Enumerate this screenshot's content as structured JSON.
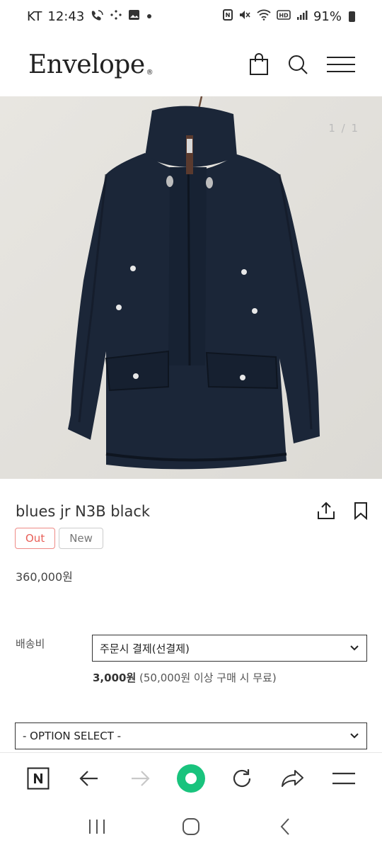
{
  "status_bar": {
    "carrier": "KT",
    "time": "12:43",
    "battery": "91%",
    "icons_left": [
      "wifi-call-icon",
      "dots-icon",
      "gallery-icon",
      "dot-icon"
    ],
    "icons_right": [
      "nfc-icon",
      "mute-icon",
      "wifi-icon",
      "hd-icon",
      "signal-icon",
      "battery-icon"
    ]
  },
  "header": {
    "logo": "Envelope",
    "logo_mark": "®",
    "icons": [
      "shopping-bag-icon",
      "search-icon",
      "menu-icon"
    ]
  },
  "gallery": {
    "counter": "1 / 1"
  },
  "product": {
    "title": "blues jr N3B black",
    "badges": {
      "out": "Out",
      "new": "New"
    },
    "price": "360,000원"
  },
  "shipping": {
    "label": "배송비",
    "method": "주문시 결제(선결제)",
    "fee": "3,000원",
    "fee_note": " (50,000원 이상 구매 시 무료)"
  },
  "option": {
    "selected": "- OPTION SELECT -"
  },
  "browser_toolbar": {
    "buttons": [
      "naver-home-icon",
      "back-icon",
      "forward-icon",
      "green-dot-icon",
      "reload-icon",
      "share-icon",
      "menu-icon"
    ]
  },
  "android_nav": {
    "buttons": [
      "recents-icon",
      "home-icon",
      "back-icon"
    ]
  },
  "colors": {
    "out_badge": "#e85f58",
    "green_dot": "#19c37d",
    "jacket": "#1b2638"
  }
}
